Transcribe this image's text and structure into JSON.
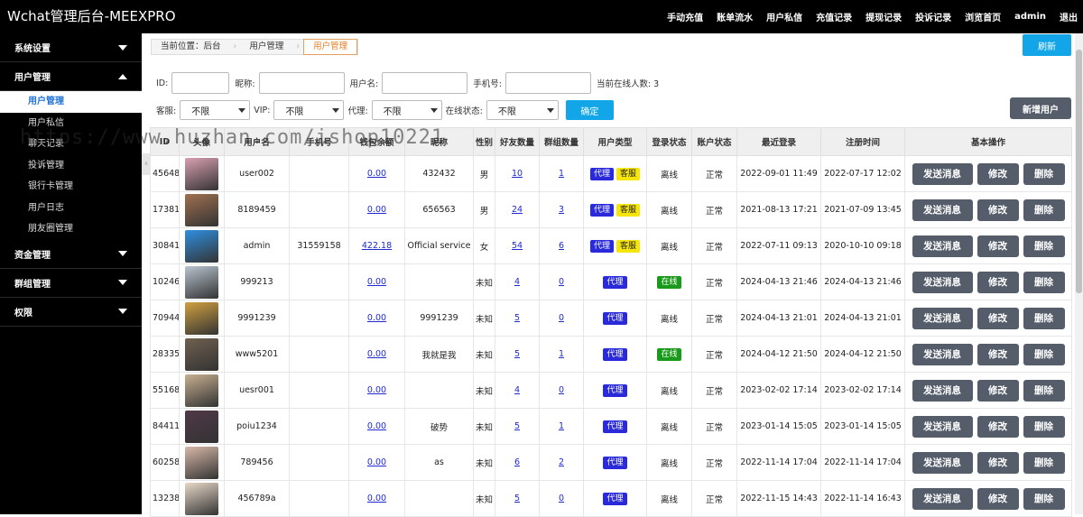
{
  "app": {
    "title": "Wchat管理后台-MEEXPRO",
    "topnav": [
      "手动充值",
      "账单流水",
      "用户私信",
      "充值记录",
      "提现记录",
      "投诉记录",
      "浏览首页",
      "admin",
      "退出"
    ]
  },
  "sidebar": {
    "groups": [
      {
        "label": "系统设置",
        "expanded": false,
        "items": []
      },
      {
        "label": "用户管理",
        "expanded": true,
        "items": [
          {
            "label": "用户管理",
            "active": true
          },
          {
            "label": "用户私信",
            "active": false
          },
          {
            "label": "聊天记录",
            "active": false
          },
          {
            "label": "投诉管理",
            "active": false
          },
          {
            "label": "银行卡管理",
            "active": false
          },
          {
            "label": "用户日志",
            "active": false
          },
          {
            "label": "朋友圈管理",
            "active": false
          }
        ]
      },
      {
        "label": "资金管理",
        "expanded": false,
        "items": []
      },
      {
        "label": "群组管理",
        "expanded": false,
        "items": []
      },
      {
        "label": "权限",
        "expanded": false,
        "items": []
      }
    ]
  },
  "breadcrumb": {
    "prefix": "当前位置：后台",
    "level1": "用户管理",
    "current": "用户管理"
  },
  "refresh_label": "刷新",
  "filters": {
    "id_label": "ID:",
    "nickname_label": "昵称:",
    "username_label": "用户名:",
    "phone_label": "手机号:",
    "online_count_label": "当前在线人数: 3",
    "cs_label": "客服:",
    "cs_value": "不限",
    "vip_label": "VIP:",
    "vip_value": "不限",
    "agent_label": "代理:",
    "agent_value": "不限",
    "online_label": "在线状态:",
    "online_value": "不限",
    "confirm_label": "确定"
  },
  "add_user_label": "新增用户",
  "table": {
    "headers": [
      "ID",
      "头像",
      "用户名",
      "手机号",
      "钱包余额",
      "昵称",
      "性别",
      "好友数量",
      "群组数量",
      "用户类型",
      "登录状态",
      "账户状态",
      "最近登录",
      "注册时间",
      "基本操作"
    ],
    "rows": [
      {
        "id": "45648",
        "username": "user002",
        "phone": "",
        "balance": "0.00",
        "nickname": "432432",
        "gender": "男",
        "friends": "10",
        "groups": "1",
        "agent": true,
        "cs": true,
        "login": "离线",
        "status": "正常",
        "last": "2022-09-01 11:49",
        "reg": "2022-07-17 12:02",
        "avatar": "#d9a0b0"
      },
      {
        "id": "17381",
        "username": "8189459",
        "phone": "",
        "balance": "0.00",
        "nickname": "656563",
        "gender": "男",
        "friends": "24",
        "groups": "3",
        "agent": true,
        "cs": true,
        "login": "离线",
        "status": "正常",
        "last": "2021-08-13 17:21",
        "reg": "2021-07-09 13:45",
        "avatar": "#a07050"
      },
      {
        "id": "30841",
        "username": "admin",
        "phone": "31559158",
        "balance": "422.18",
        "nickname": "Official service",
        "gender": "女",
        "friends": "54",
        "groups": "6",
        "agent": true,
        "cs": true,
        "login": "离线",
        "status": "正常",
        "last": "2022-07-11 09:13",
        "reg": "2020-10-10 09:18",
        "avatar": "#2f8fe0"
      },
      {
        "id": "10246",
        "username": "999213",
        "phone": "",
        "balance": "0.00",
        "nickname": "",
        "gender": "未知",
        "friends": "4",
        "groups": "0",
        "agent": true,
        "cs": false,
        "login": "在线",
        "status": "正常",
        "last": "2024-04-13 21:46",
        "reg": "2024-04-13 21:46",
        "avatar": "#b8c4d0"
      },
      {
        "id": "70944",
        "username": "9991239",
        "phone": "",
        "balance": "0.00",
        "nickname": "9991239",
        "gender": "未知",
        "friends": "5",
        "groups": "0",
        "agent": true,
        "cs": false,
        "login": "离线",
        "status": "正常",
        "last": "2024-04-13 21:01",
        "reg": "2024-04-13 21:01",
        "avatar": "#d0a040"
      },
      {
        "id": "28335",
        "username": "www5201",
        "phone": "",
        "balance": "0.00",
        "nickname": "我就是我",
        "gender": "未知",
        "friends": "5",
        "groups": "1",
        "agent": true,
        "cs": false,
        "login": "在线",
        "status": "正常",
        "last": "2024-04-12 21:50",
        "reg": "2024-04-12 21:50",
        "avatar": "#706050"
      },
      {
        "id": "55168",
        "username": "uesr001",
        "phone": "",
        "balance": "0.00",
        "nickname": "",
        "gender": "未知",
        "friends": "4",
        "groups": "0",
        "agent": true,
        "cs": false,
        "login": "离线",
        "status": "正常",
        "last": "2023-02-02 17:14",
        "reg": "2023-02-02 17:14",
        "avatar": "#c8b090"
      },
      {
        "id": "84411",
        "username": "poiu1234",
        "phone": "",
        "balance": "0.00",
        "nickname": "破势",
        "gender": "未知",
        "friends": "5",
        "groups": "1",
        "agent": true,
        "cs": false,
        "login": "离线",
        "status": "正常",
        "last": "2023-01-14 15:05",
        "reg": "2023-01-14 15:05",
        "avatar": "#503848"
      },
      {
        "id": "60258",
        "username": "789456",
        "phone": "",
        "balance": "0.00",
        "nickname": "as",
        "gender": "未知",
        "friends": "6",
        "groups": "2",
        "agent": true,
        "cs": false,
        "login": "离线",
        "status": "正常",
        "last": "2022-11-14 17:04",
        "reg": "2022-11-14 17:04",
        "avatar": "#d8b8a8"
      },
      {
        "id": "13238",
        "username": "456789a",
        "phone": "",
        "balance": "0.00",
        "nickname": "",
        "gender": "未知",
        "friends": "5",
        "groups": "0",
        "agent": true,
        "cs": false,
        "login": "离线",
        "status": "正常",
        "last": "2022-11-15 14:43",
        "reg": "2022-11-14 16:43",
        "avatar": "#e8d8c8"
      }
    ],
    "agent_tag": "代理",
    "cs_tag": "客服",
    "online_tag": "在线",
    "send_label": "发送消息",
    "edit_label": "修改",
    "delete_label": "删除"
  },
  "watermark": "https://www.huzhan.com/ishop10221"
}
